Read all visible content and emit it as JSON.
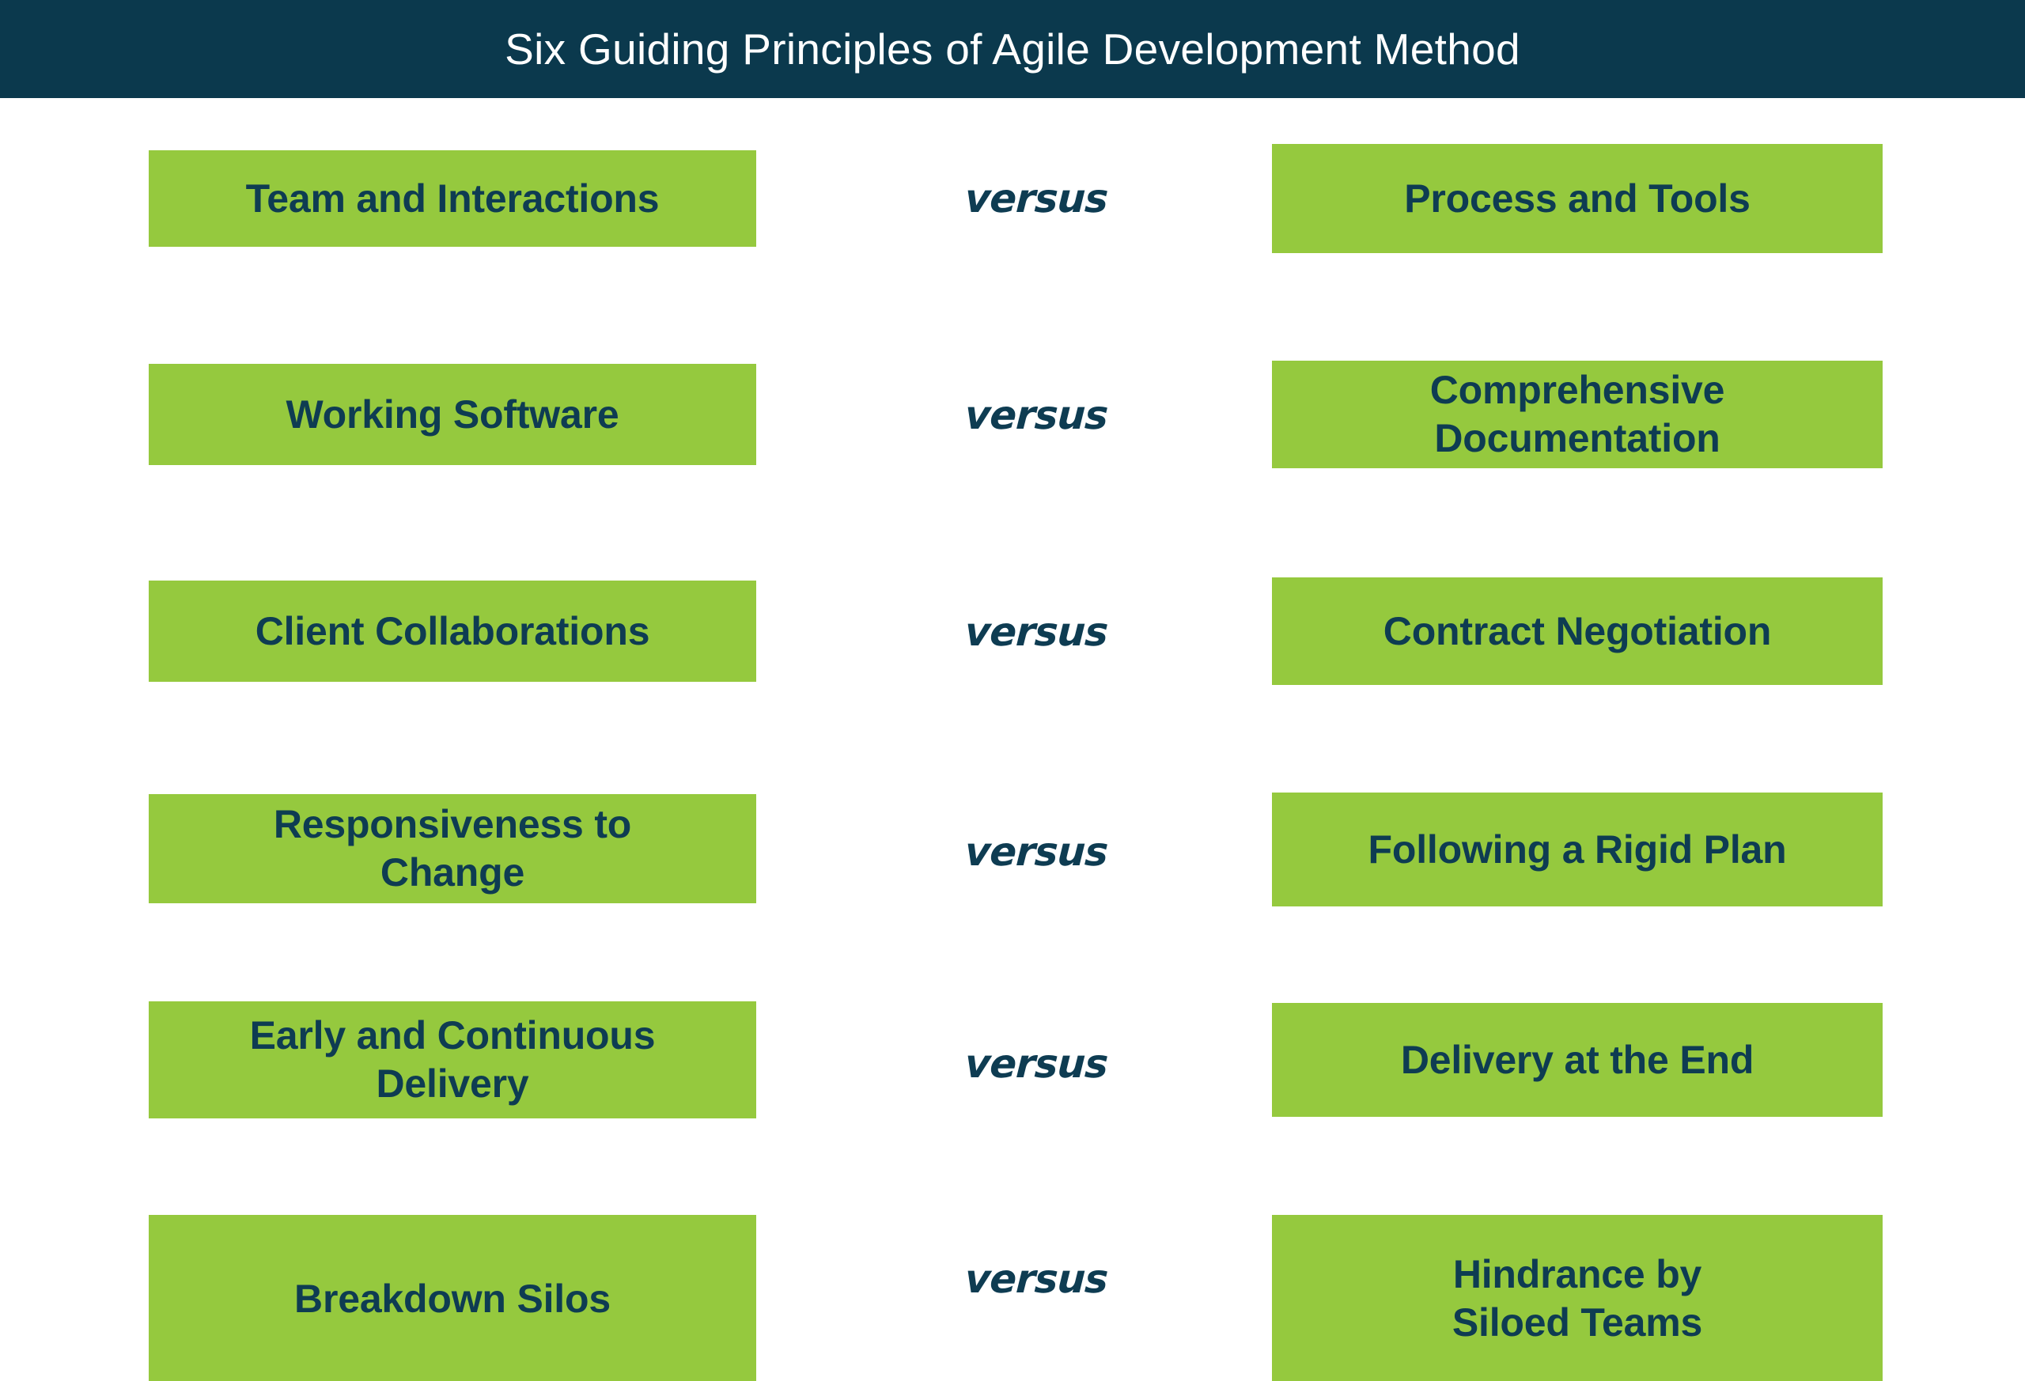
{
  "header": {
    "title": "Six Guiding Principles of Agile Development Method"
  },
  "theme": {
    "header_bg": "#0b394d",
    "header_text": "#ffffff",
    "box_bg": "#95c93e",
    "box_text": "#0e3c52",
    "page_bg": "#ffffff"
  },
  "versus_label": "versus",
  "rows": [
    {
      "left": "Team and Interactions",
      "connector": "versus",
      "right": "Process and Tools"
    },
    {
      "left": "Working Software",
      "connector": "versus",
      "right": "Comprehensive\nDocumentation"
    },
    {
      "left": "Client Collaborations",
      "connector": "versus",
      "right": "Contract Negotiation"
    },
    {
      "left": "Responsiveness to\nChange",
      "connector": "versus",
      "right": "Following a Rigid Plan"
    },
    {
      "left": "Early and Continuous\nDelivery",
      "connector": "versus",
      "right": "Delivery at the End"
    },
    {
      "left": "Breakdown Silos",
      "connector": "versus",
      "right": "Hindrance by\nSiloed Teams"
    }
  ]
}
